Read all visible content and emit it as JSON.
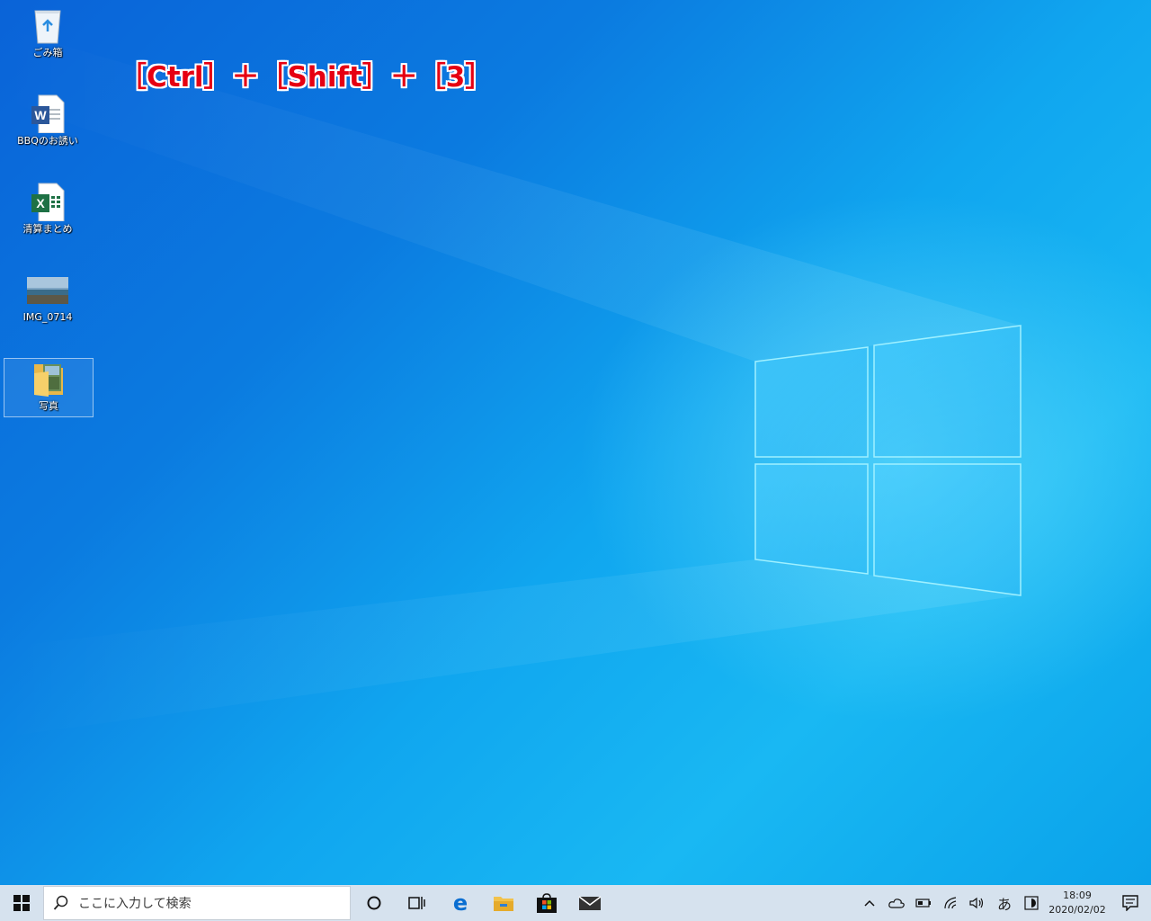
{
  "desktop": {
    "icons": [
      {
        "label": "ごみ箱",
        "icon": "recycle-bin-icon"
      },
      {
        "label": "BBQのお誘い",
        "icon": "word-document-icon"
      },
      {
        "label": "清算まとめ",
        "icon": "excel-workbook-icon"
      },
      {
        "label": "IMG_0714",
        "icon": "image-file-icon"
      },
      {
        "label": "写真",
        "icon": "folder-icon"
      }
    ],
    "caption": "［Ctrl］＋［Shift］＋［3］"
  },
  "taskbar": {
    "search_placeholder": "ここに入力して検索",
    "pinned": [
      "cortana-icon",
      "task-view-icon",
      "edge-icon",
      "file-explorer-icon",
      "store-icon",
      "mail-icon"
    ],
    "tray": {
      "ime": "あ",
      "time": "18:09",
      "date": "2020/02/02"
    }
  },
  "colors": {
    "caption_red": "#e60012",
    "taskbar_bg": "#d6e2ee",
    "edge_blue": "#0a6ed1"
  }
}
